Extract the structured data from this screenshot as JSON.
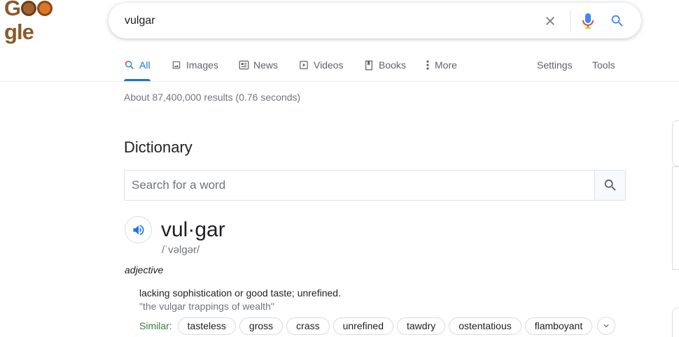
{
  "logo": {
    "alt": "Google",
    "letters": [
      "G",
      "o",
      "o",
      "g",
      "l",
      "e"
    ]
  },
  "search": {
    "query": "vulgar"
  },
  "icons": {
    "clear": "close-icon",
    "voice": "mic-icon",
    "search": "search-icon",
    "speaker": "speaker-icon",
    "expand": "chevron-down-icon"
  },
  "tabs": [
    {
      "label": "All",
      "icon": "search-icon",
      "active": true
    },
    {
      "label": "Images",
      "icon": "image-icon"
    },
    {
      "label": "News",
      "icon": "news-icon"
    },
    {
      "label": "Videos",
      "icon": "video-icon"
    },
    {
      "label": "Books",
      "icon": "book-icon"
    },
    {
      "label": "More",
      "icon": "more-vert-icon"
    }
  ],
  "tools": {
    "settings": "Settings",
    "tools": "Tools"
  },
  "result_stats": "About 87,400,000 results (0.76 seconds)",
  "dictionary": {
    "heading": "Dictionary",
    "search_placeholder": "Search for a word",
    "headword": "vul·gar",
    "phonetic": "/ˈvəlɡər/",
    "part_of_speech": "adjective",
    "definition": "lacking sophistication or good taste; unrefined.",
    "example": "\"the vulgar trappings of wealth\"",
    "similar_label": "Similar:",
    "similar": [
      "tasteless",
      "gross",
      "crass",
      "unrefined",
      "tawdry",
      "ostentatious",
      "flamboyant"
    ]
  },
  "colors": {
    "accent_blue": "#1a73e8",
    "text_secondary": "#70757a",
    "logo_brown": "#8a5a2b",
    "similar_green": "#3c7a3c"
  }
}
